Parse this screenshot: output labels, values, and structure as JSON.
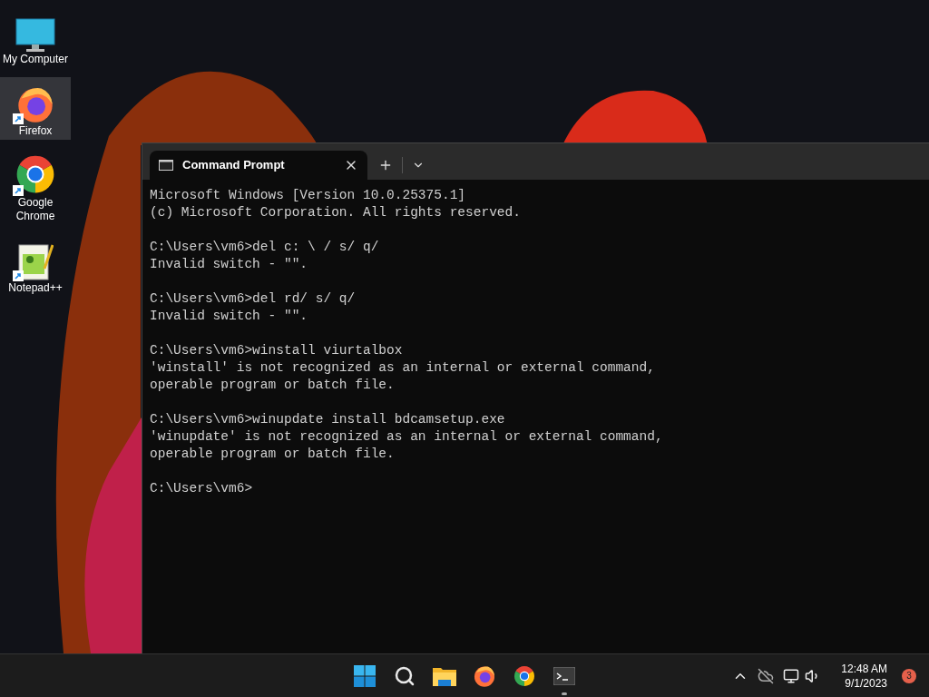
{
  "desktop_icons": [
    {
      "kind": "computer",
      "label": "My Computer",
      "shortcut": false,
      "selected": false
    },
    {
      "kind": "firefox",
      "label": "Firefox",
      "shortcut": true,
      "selected": true
    },
    {
      "kind": "chrome",
      "label": "Google Chrome",
      "shortcut": true,
      "selected": false
    },
    {
      "kind": "notepad",
      "label": "Notepad++",
      "shortcut": true,
      "selected": false
    }
  ],
  "terminal": {
    "tabs": [
      {
        "title": "Command Prompt",
        "selected": true
      }
    ],
    "blocks": [
      [
        "Microsoft Windows [Version 10.0.25375.1]",
        "(c) Microsoft Corporation. All rights reserved."
      ],
      [
        "C:\\Users\\vm6>del c: \\ / s/ q/",
        "Invalid switch - \"\"."
      ],
      [
        "C:\\Users\\vm6>del rd/ s/ q/",
        "Invalid switch - \"\"."
      ],
      [
        "C:\\Users\\vm6>winstall viurtalbox",
        "'winstall' is not recognized as an internal or external command,",
        "operable program or batch file."
      ],
      [
        "C:\\Users\\vm6>winupdate install bdcamsetup.exe",
        "'winupdate' is not recognized as an internal or external command,",
        "operable program or batch file."
      ],
      [
        "C:\\Users\\vm6>"
      ]
    ]
  },
  "taskbar": {
    "apps": [
      {
        "kind": "start",
        "active": false
      },
      {
        "kind": "search",
        "active": false
      },
      {
        "kind": "explorer",
        "active": false
      },
      {
        "kind": "firefox",
        "active": false
      },
      {
        "kind": "chrome",
        "active": false
      },
      {
        "kind": "terminal",
        "active": true
      }
    ],
    "tray": {
      "time": "12:48 AM",
      "date": "9/1/2023",
      "notifications": "3"
    }
  }
}
